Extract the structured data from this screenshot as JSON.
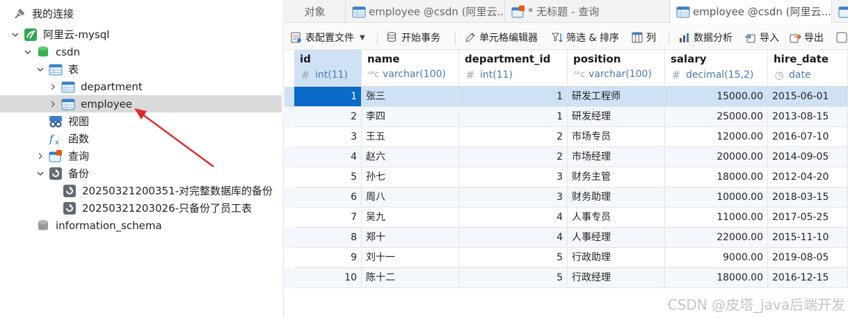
{
  "sidebar": {
    "connections_title": "我的连接",
    "connection_name": "阿里云-mysql",
    "db_csdn": "csdn",
    "tables_node": "表",
    "tables": [
      "department",
      "employee"
    ],
    "views_node": "视图",
    "functions_node": "函数",
    "queries_node": "查询",
    "backups_node": "备份",
    "backups": [
      "20250321200351-对完整数据库的备份",
      "20250321203026-只备份了员工表"
    ],
    "db_info": "information_schema"
  },
  "tabs": [
    {
      "label": "对象"
    },
    {
      "label": "employee @csdn (阿里云..."
    },
    {
      "label": "* 无标题 - 查询"
    },
    {
      "label": "employee @csdn (阿里云..."
    }
  ],
  "toolbar": {
    "table_config": "表配置文件",
    "begin_tx": "开始事务",
    "cell_editor": "单元格编辑器",
    "filter_sort": "筛选 & 排序",
    "columns": "列",
    "data_analysis": "数据分析",
    "import": "导入",
    "export": "导出"
  },
  "columns": [
    {
      "name": "id",
      "type": "int(11)",
      "glyph": "#"
    },
    {
      "name": "name",
      "type": "varchar(100)",
      "glyph": "ABC"
    },
    {
      "name": "department_id",
      "type": "int(11)",
      "glyph": "#"
    },
    {
      "name": "position",
      "type": "varchar(100)",
      "glyph": "ABC"
    },
    {
      "name": "salary",
      "type": "decimal(15,2)",
      "glyph": "#"
    },
    {
      "name": "hire_date",
      "type": "date",
      "glyph": "clock"
    }
  ],
  "rows": [
    [
      "1",
      "张三",
      "1",
      "研发工程师",
      "15000.00",
      "2015-06-01"
    ],
    [
      "2",
      "李四",
      "1",
      "研发经理",
      "25000.00",
      "2013-08-15"
    ],
    [
      "3",
      "王五",
      "2",
      "市场专员",
      "12000.00",
      "2016-07-10"
    ],
    [
      "4",
      "赵六",
      "2",
      "市场经理",
      "20000.00",
      "2014-09-05"
    ],
    [
      "5",
      "孙七",
      "3",
      "财务主管",
      "18000.00",
      "2012-04-20"
    ],
    [
      "6",
      "周八",
      "3",
      "财务助理",
      "10000.00",
      "2018-03-15"
    ],
    [
      "7",
      "吴九",
      "4",
      "人事专员",
      "11000.00",
      "2017-05-25"
    ],
    [
      "8",
      "郑十",
      "4",
      "人事经理",
      "22000.00",
      "2015-11-10"
    ],
    [
      "9",
      "刘十一",
      "5",
      "行政助理",
      "9000.00",
      "2019-08-05"
    ],
    [
      "10",
      "陈十二",
      "5",
      "行政经理",
      "18000.00",
      "2016-12-15"
    ]
  ],
  "watermark": "CSDN @皮塔_java后端开发",
  "colors": {
    "selection": "#cfe1f5",
    "id_selected": "#0a6ac7",
    "arrow": "#e02a2a",
    "type_text": "#4a78b5"
  }
}
